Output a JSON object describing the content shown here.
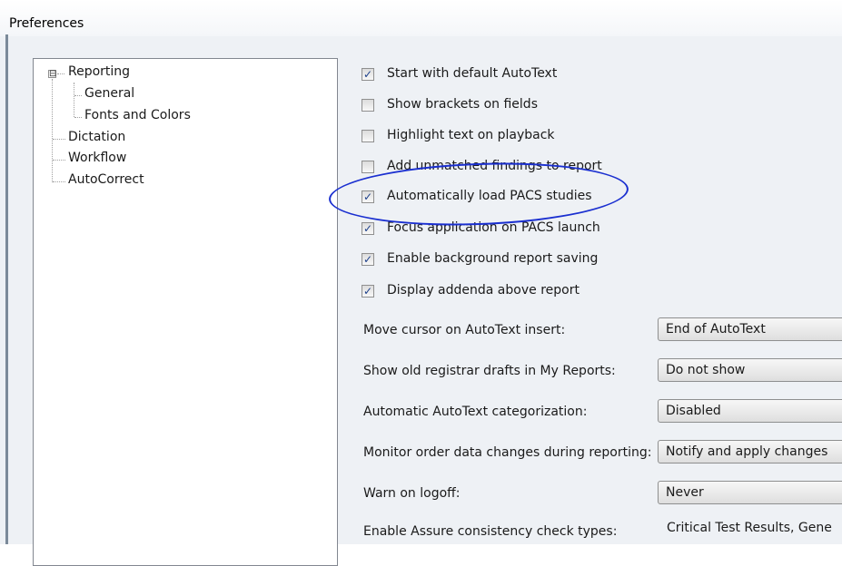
{
  "window": {
    "title": "Preferences"
  },
  "tree": {
    "items": [
      {
        "label": "Reporting",
        "expander": "⊟"
      },
      {
        "label": "General"
      },
      {
        "label": "Fonts and Colors"
      },
      {
        "label": "Dictation"
      },
      {
        "label": "Workflow"
      },
      {
        "label": "AutoCorrect"
      }
    ]
  },
  "options": {
    "checkboxes": [
      {
        "label": "Start with default AutoText",
        "checked": true,
        "mark": "✓"
      },
      {
        "label": "Show brackets on fields",
        "checked": false,
        "mark": ""
      },
      {
        "label": "Highlight text on playback",
        "checked": false,
        "mark": ""
      },
      {
        "label": "Add unmatched findings to report",
        "checked": false,
        "mark": ""
      },
      {
        "label": "Automatically load PACS studies",
        "checked": true,
        "mark": "✓"
      },
      {
        "label": "Focus application on PACS launch",
        "checked": true,
        "mark": "✓"
      },
      {
        "label": "Enable background report saving",
        "checked": true,
        "mark": "✓"
      },
      {
        "label": "Display addenda above report",
        "checked": true,
        "mark": "✓"
      }
    ],
    "settings": [
      {
        "label": "Move cursor on AutoText insert:",
        "value": "End of AutoText"
      },
      {
        "label": "Show old registrar drafts in My Reports:",
        "value": "Do not show"
      },
      {
        "label": "Automatic AutoText categorization:",
        "value": "Disabled"
      },
      {
        "label": "Monitor order data changes during reporting:",
        "value": "Notify and apply changes"
      },
      {
        "label": "Warn on logoff:",
        "value": "Never"
      },
      {
        "label": "Enable Assure consistency check types:",
        "value": "Critical Test Results, Gene"
      }
    ]
  },
  "annotation": {
    "color": "#1a2fd0"
  }
}
